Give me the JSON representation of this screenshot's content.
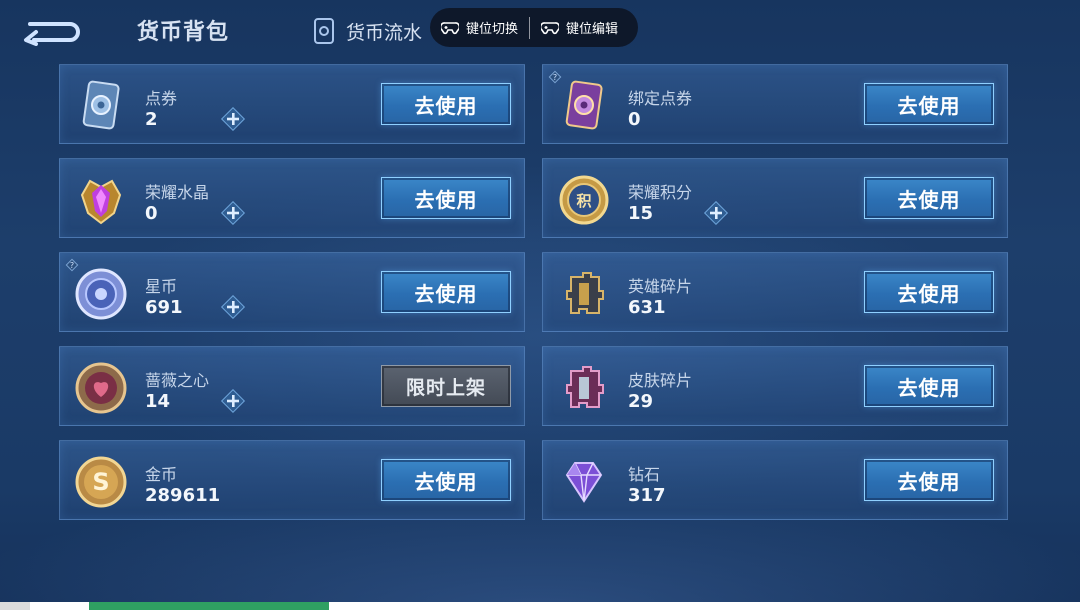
{
  "header": {
    "title": "货币背包",
    "tab_flow_label": "货币流水"
  },
  "keybar": {
    "switch_label": "键位切换",
    "edit_label": "键位编辑"
  },
  "currencies": [
    {
      "name": "点券",
      "amount": "2",
      "action": "去使用",
      "has_plus": true,
      "icon": "coupon-card-icon"
    },
    {
      "name": "绑定点券",
      "amount": "0",
      "action": "去使用",
      "has_plus": false,
      "icon": "bound-coupon-card-icon"
    },
    {
      "name": "荣耀水晶",
      "amount": "0",
      "action": "去使用",
      "has_plus": true,
      "icon": "glory-crystal-icon"
    },
    {
      "name": "荣耀积分",
      "amount": "15",
      "action": "去使用",
      "has_plus": true,
      "icon": "glory-points-icon"
    },
    {
      "name": "星币",
      "amount": "691",
      "action": "去使用",
      "has_plus": true,
      "icon": "star-coin-icon"
    },
    {
      "name": "英雄碎片",
      "amount": "631",
      "action": "去使用",
      "has_plus": false,
      "icon": "hero-fragment-icon"
    },
    {
      "name": "蔷薇之心",
      "amount": "14",
      "action": "限时上架",
      "has_plus": true,
      "icon": "rose-heart-icon"
    },
    {
      "name": "皮肤碎片",
      "amount": "29",
      "action": "去使用",
      "has_plus": false,
      "icon": "skin-fragment-icon"
    },
    {
      "name": "金币",
      "amount": "289611",
      "action": "去使用",
      "has_plus": false,
      "icon": "gold-coin-icon"
    },
    {
      "name": "钻石",
      "amount": "317",
      "action": "去使用",
      "has_plus": false,
      "icon": "diamond-icon"
    }
  ],
  "colors": {
    "action_blue": "#2b6fb3",
    "limited_gray": "#4b525d",
    "background": "#1d3e6b"
  }
}
